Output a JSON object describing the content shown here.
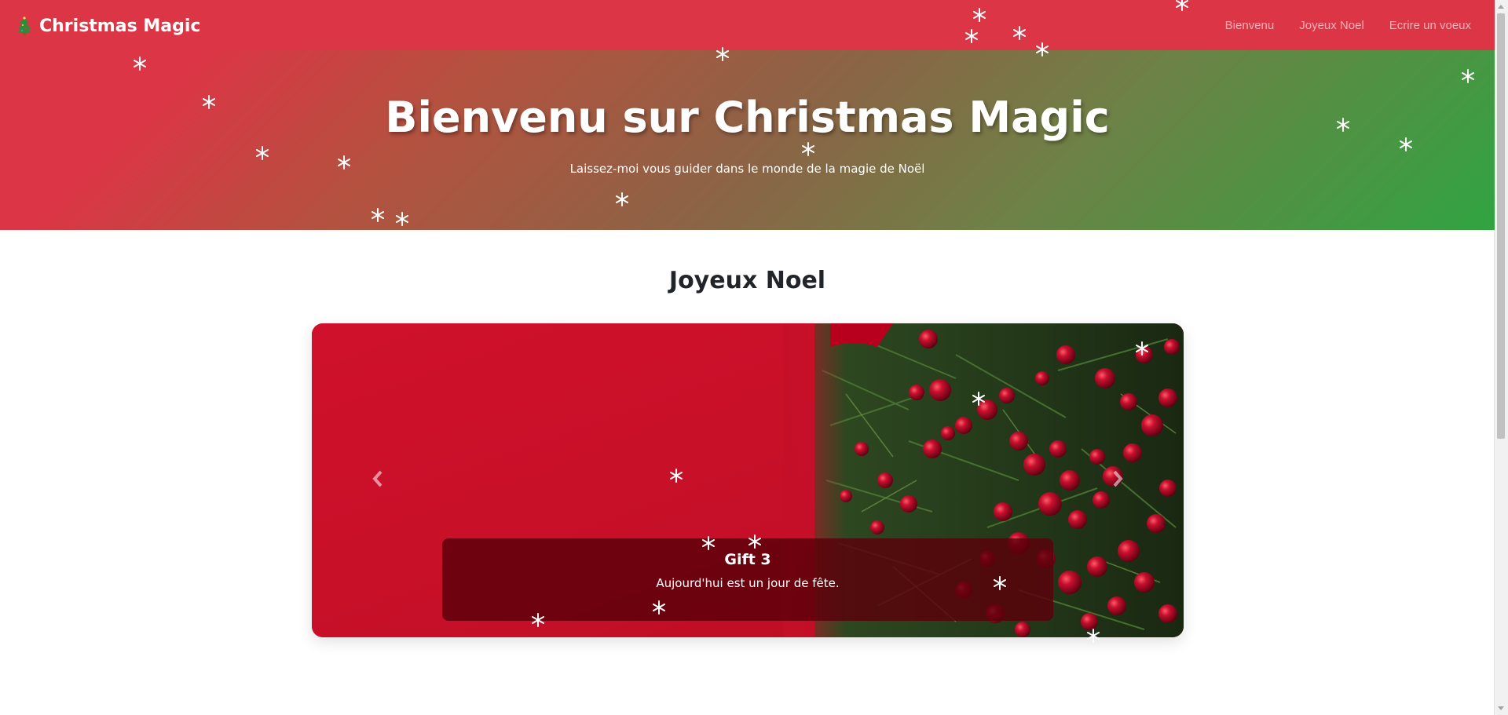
{
  "navbar": {
    "brand": "Christmas Magic",
    "brand_icon": "christmas-tree-icon",
    "links": [
      "Bienvenu",
      "Joyeux Noel",
      "Ecrire un voeux"
    ]
  },
  "hero": {
    "title": "Bienvenu sur Christmas Magic",
    "subtitle": "Laissez-moi vous guider dans le monde de la magie de Noël"
  },
  "section": {
    "title": "Joyeux Noel"
  },
  "carousel": {
    "caption_title": "Gift 3",
    "caption_text": "Aujourd'hui est un jour de fête.",
    "prev_icon": "chevron-left-icon",
    "next_icon": "chevron-right-icon"
  },
  "colors": {
    "navbar": "#dc3545",
    "hero_start": "#dc3545",
    "hero_end": "#30a441",
    "caption_bg": "#5a000a"
  }
}
